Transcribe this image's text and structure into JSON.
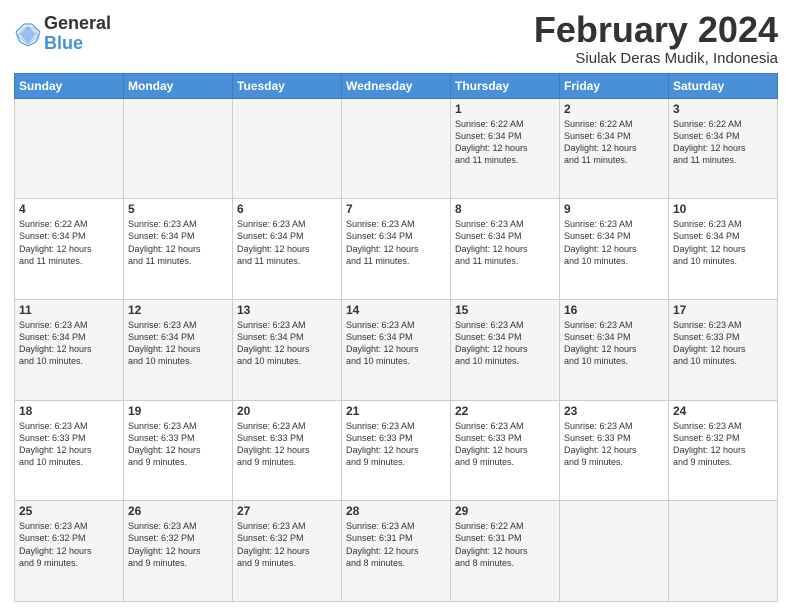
{
  "header": {
    "logo": {
      "general": "General",
      "blue": "Blue"
    },
    "title": "February 2024",
    "subtitle": "Siulak Deras Mudik, Indonesia"
  },
  "calendar": {
    "weekdays": [
      "Sunday",
      "Monday",
      "Tuesday",
      "Wednesday",
      "Thursday",
      "Friday",
      "Saturday"
    ],
    "weeks": [
      [
        {
          "day": "",
          "info": ""
        },
        {
          "day": "",
          "info": ""
        },
        {
          "day": "",
          "info": ""
        },
        {
          "day": "",
          "info": ""
        },
        {
          "day": "1",
          "info": "Sunrise: 6:22 AM\nSunset: 6:34 PM\nDaylight: 12 hours\nand 11 minutes."
        },
        {
          "day": "2",
          "info": "Sunrise: 6:22 AM\nSunset: 6:34 PM\nDaylight: 12 hours\nand 11 minutes."
        },
        {
          "day": "3",
          "info": "Sunrise: 6:22 AM\nSunset: 6:34 PM\nDaylight: 12 hours\nand 11 minutes."
        }
      ],
      [
        {
          "day": "4",
          "info": "Sunrise: 6:22 AM\nSunset: 6:34 PM\nDaylight: 12 hours\nand 11 minutes."
        },
        {
          "day": "5",
          "info": "Sunrise: 6:23 AM\nSunset: 6:34 PM\nDaylight: 12 hours\nand 11 minutes."
        },
        {
          "day": "6",
          "info": "Sunrise: 6:23 AM\nSunset: 6:34 PM\nDaylight: 12 hours\nand 11 minutes."
        },
        {
          "day": "7",
          "info": "Sunrise: 6:23 AM\nSunset: 6:34 PM\nDaylight: 12 hours\nand 11 minutes."
        },
        {
          "day": "8",
          "info": "Sunrise: 6:23 AM\nSunset: 6:34 PM\nDaylight: 12 hours\nand 11 minutes."
        },
        {
          "day": "9",
          "info": "Sunrise: 6:23 AM\nSunset: 6:34 PM\nDaylight: 12 hours\nand 10 minutes."
        },
        {
          "day": "10",
          "info": "Sunrise: 6:23 AM\nSunset: 6:34 PM\nDaylight: 12 hours\nand 10 minutes."
        }
      ],
      [
        {
          "day": "11",
          "info": "Sunrise: 6:23 AM\nSunset: 6:34 PM\nDaylight: 12 hours\nand 10 minutes."
        },
        {
          "day": "12",
          "info": "Sunrise: 6:23 AM\nSunset: 6:34 PM\nDaylight: 12 hours\nand 10 minutes."
        },
        {
          "day": "13",
          "info": "Sunrise: 6:23 AM\nSunset: 6:34 PM\nDaylight: 12 hours\nand 10 minutes."
        },
        {
          "day": "14",
          "info": "Sunrise: 6:23 AM\nSunset: 6:34 PM\nDaylight: 12 hours\nand 10 minutes."
        },
        {
          "day": "15",
          "info": "Sunrise: 6:23 AM\nSunset: 6:34 PM\nDaylight: 12 hours\nand 10 minutes."
        },
        {
          "day": "16",
          "info": "Sunrise: 6:23 AM\nSunset: 6:34 PM\nDaylight: 12 hours\nand 10 minutes."
        },
        {
          "day": "17",
          "info": "Sunrise: 6:23 AM\nSunset: 6:33 PM\nDaylight: 12 hours\nand 10 minutes."
        }
      ],
      [
        {
          "day": "18",
          "info": "Sunrise: 6:23 AM\nSunset: 6:33 PM\nDaylight: 12 hours\nand 10 minutes."
        },
        {
          "day": "19",
          "info": "Sunrise: 6:23 AM\nSunset: 6:33 PM\nDaylight: 12 hours\nand 9 minutes."
        },
        {
          "day": "20",
          "info": "Sunrise: 6:23 AM\nSunset: 6:33 PM\nDaylight: 12 hours\nand 9 minutes."
        },
        {
          "day": "21",
          "info": "Sunrise: 6:23 AM\nSunset: 6:33 PM\nDaylight: 12 hours\nand 9 minutes."
        },
        {
          "day": "22",
          "info": "Sunrise: 6:23 AM\nSunset: 6:33 PM\nDaylight: 12 hours\nand 9 minutes."
        },
        {
          "day": "23",
          "info": "Sunrise: 6:23 AM\nSunset: 6:33 PM\nDaylight: 12 hours\nand 9 minutes."
        },
        {
          "day": "24",
          "info": "Sunrise: 6:23 AM\nSunset: 6:32 PM\nDaylight: 12 hours\nand 9 minutes."
        }
      ],
      [
        {
          "day": "25",
          "info": "Sunrise: 6:23 AM\nSunset: 6:32 PM\nDaylight: 12 hours\nand 9 minutes."
        },
        {
          "day": "26",
          "info": "Sunrise: 6:23 AM\nSunset: 6:32 PM\nDaylight: 12 hours\nand 9 minutes."
        },
        {
          "day": "27",
          "info": "Sunrise: 6:23 AM\nSunset: 6:32 PM\nDaylight: 12 hours\nand 9 minutes."
        },
        {
          "day": "28",
          "info": "Sunrise: 6:23 AM\nSunset: 6:31 PM\nDaylight: 12 hours\nand 8 minutes."
        },
        {
          "day": "29",
          "info": "Sunrise: 6:22 AM\nSunset: 6:31 PM\nDaylight: 12 hours\nand 8 minutes."
        },
        {
          "day": "",
          "info": ""
        },
        {
          "day": "",
          "info": ""
        }
      ]
    ]
  }
}
